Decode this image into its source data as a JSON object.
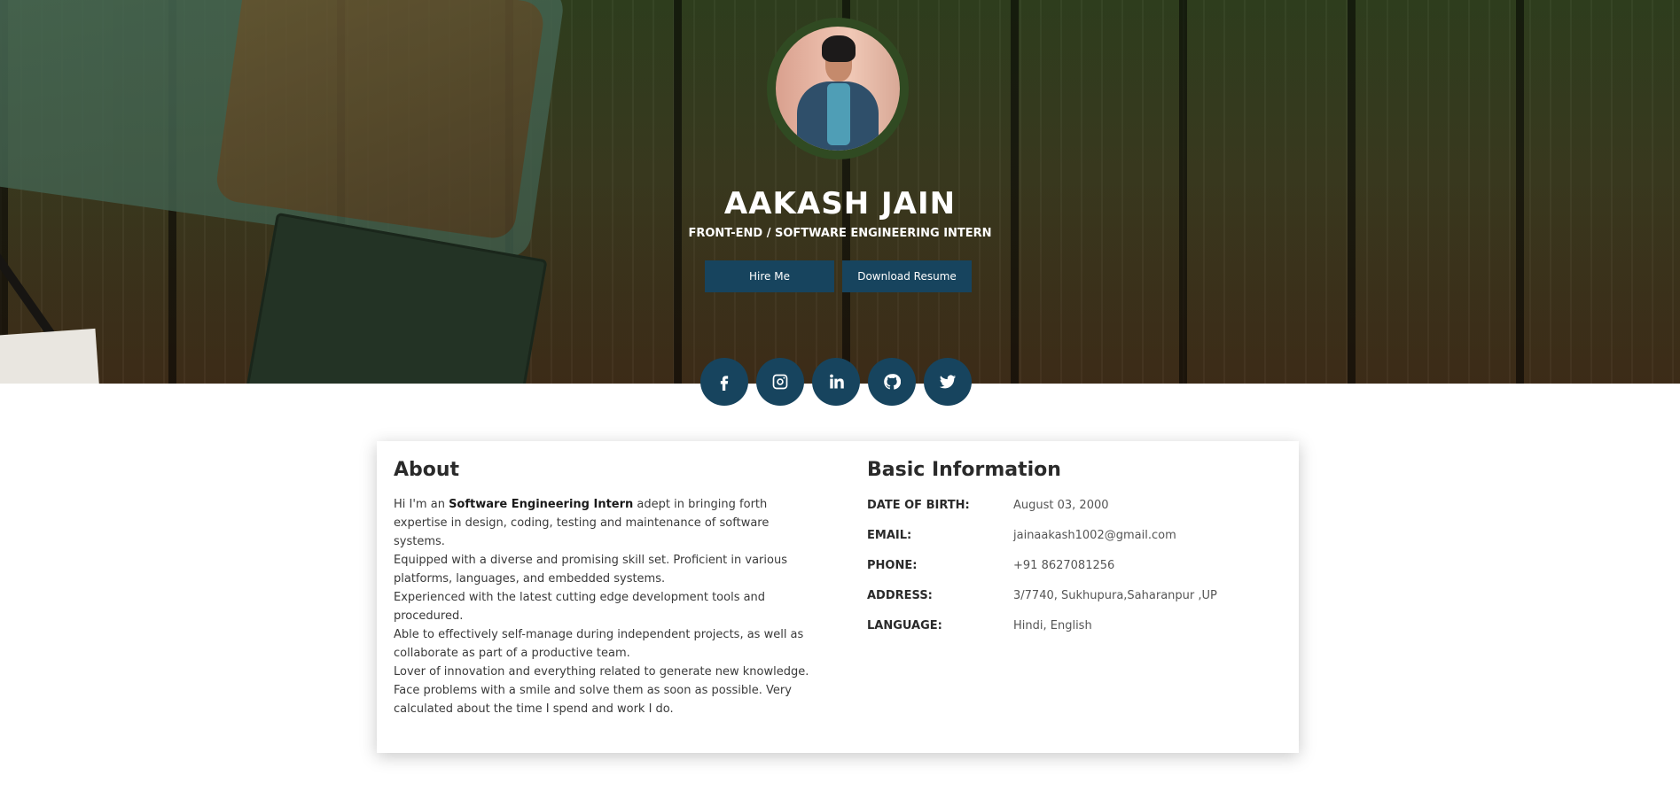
{
  "profile": {
    "name": "AAKASH JAIN",
    "title": "FRONT-END / SOFTWARE ENGINEERING INTERN",
    "hire_label": "Hire Me",
    "resume_label": "Download Resume"
  },
  "social": [
    {
      "icon": "facebook-icon"
    },
    {
      "icon": "instagram-icon"
    },
    {
      "icon": "linkedin-icon"
    },
    {
      "icon": "github-icon"
    },
    {
      "icon": "twitter-icon"
    }
  ],
  "about": {
    "heading": "About",
    "intro_prefix": "Hi I'm an ",
    "intro_bold": "Software Engineering Intern",
    "intro_rest": " adept in bringing forth expertise in design, coding, testing and maintenance of software systems.",
    "p2": "Equipped with a diverse and promising skill set. Proficient in various platforms, languages, and embedded systems.",
    "p3": "Experienced with the latest cutting edge development tools and procedured.",
    "p4": "Able to effectively self-manage during independent projects, as well as collaborate as part of a productive team.",
    "p5": "Lover of innovation and everything related to generate new knowledge. Face problems with a smile and solve them as soon as possible. Very calculated about the time I spend and work I do."
  },
  "basic": {
    "heading": "Basic Information",
    "rows": [
      {
        "label": "DATE OF BIRTH:",
        "value": "August 03, 2000"
      },
      {
        "label": "EMAIL:",
        "value": "jainaakash1002@gmail.com"
      },
      {
        "label": "PHONE:",
        "value": "+91 8627081256"
      },
      {
        "label": "ADDRESS:",
        "value": "3/7740, Sukhupura,Saharanpur ,UP"
      },
      {
        "label": "LANGUAGE:",
        "value": "Hindi, English"
      }
    ]
  },
  "colors": {
    "accent": "#17445e",
    "avatar_ring": "#304a22"
  }
}
